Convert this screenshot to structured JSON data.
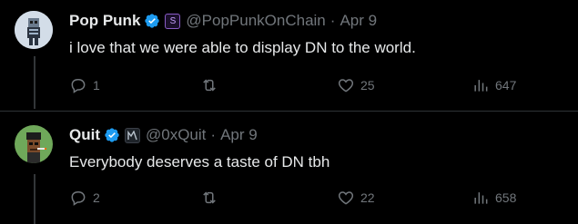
{
  "tweets": [
    {
      "name": "Pop Punk",
      "handle": "@PopPunkOnChain",
      "separator": "·",
      "date": "Apr 9",
      "affiliate_badge": "S",
      "text": "i love that we were able to display DN to the world.",
      "replies": "1",
      "retweets": "",
      "likes": "25",
      "views": "647"
    },
    {
      "name": "Quit",
      "handle": "@0xQuit",
      "separator": "·",
      "date": "Apr 9",
      "affiliate_badge": "",
      "text": "Everybody deserves a taste of DN tbh",
      "replies": "2",
      "retweets": "",
      "likes": "22",
      "views": "658"
    }
  ],
  "colors": {
    "background": "#000000",
    "text": "#e7e9ea",
    "muted": "#71767b",
    "verified": "#1d9bf0",
    "divider": "#2f3336"
  },
  "icons": [
    "verified-badge-icon",
    "affiliate-icon",
    "reply-icon",
    "retweet-icon",
    "like-icon",
    "views-icon"
  ]
}
